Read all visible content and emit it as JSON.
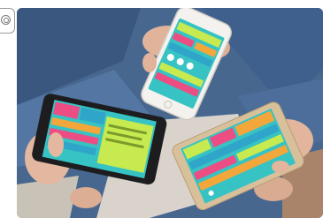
{
  "scene": {
    "subject": "hands-holding-smartphones",
    "phone_count": 3,
    "colors": {
      "denim": "#3f5f8c",
      "skin": "#e2b59c",
      "screen_teal": "#37c3c4",
      "screen_green": "#c6ea50",
      "screen_pink": "#ec4d83",
      "screen_orange": "#f3a73b",
      "phone_white": "#f4f2ef",
      "phone_black": "#1d1d1f",
      "phone_gold": "#d8c09a"
    }
  }
}
